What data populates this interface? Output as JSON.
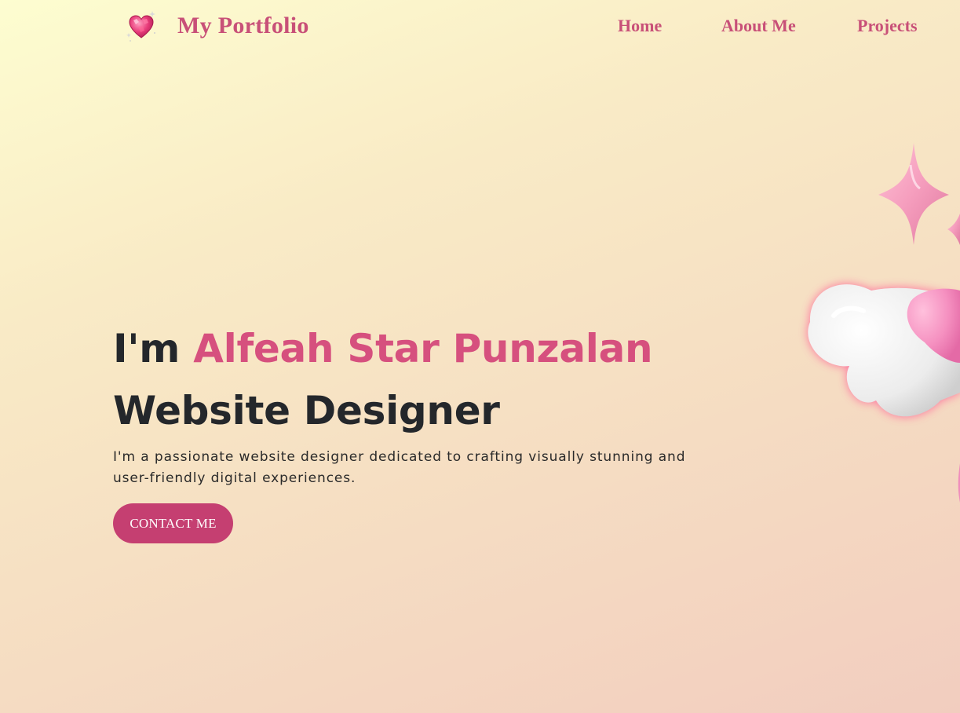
{
  "nav": {
    "brand": "My Portfolio",
    "logo_icon": "sparkling-heart-icon",
    "links": [
      {
        "label": "Home"
      },
      {
        "label": "About Me"
      },
      {
        "label": "Projects"
      }
    ]
  },
  "hero": {
    "greeting": "I'm ",
    "name": "Alfeah Star Punzalan",
    "role": "Website Designer",
    "description": "I'm a passionate website designer dedicated to crafting visually stunning and user-friendly digital experiences.",
    "cta_label": "CONTACT ME"
  },
  "decoration": {
    "icons": [
      "sparkle-star-icon",
      "winged-heart-icon"
    ]
  },
  "colors": {
    "accent": "#c85078",
    "name_highlight": "#d6507e",
    "button": "#c53f71",
    "text_dark": "#24272b"
  }
}
